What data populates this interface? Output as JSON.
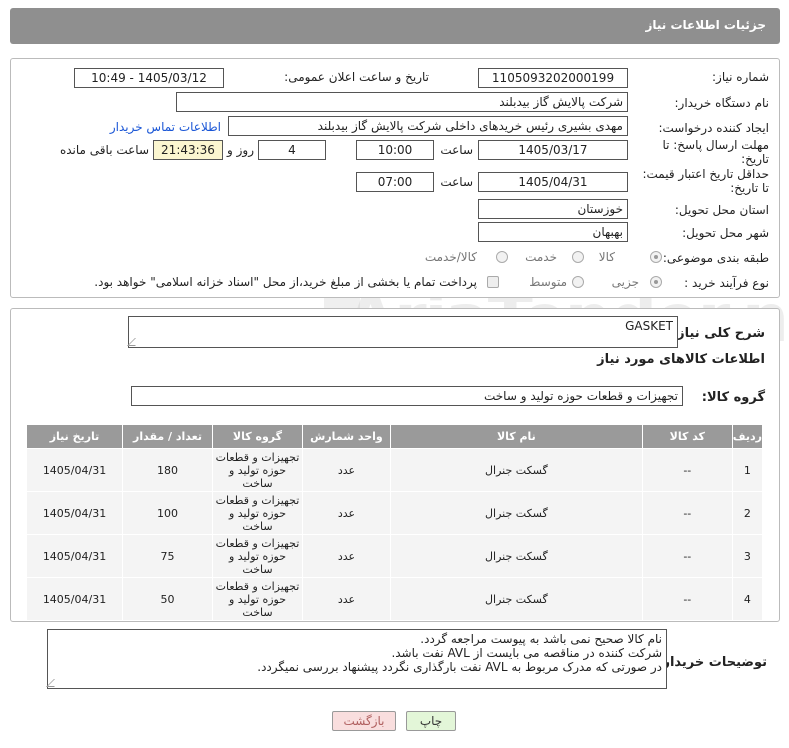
{
  "header": {
    "title": "جزئیات اطلاعات نیاز"
  },
  "form": {
    "need_number_label": "شماره نیاز:",
    "need_number": "1105093202000199",
    "announce_label": "تاریخ و ساعت اعلان عمومی:",
    "announce_value": "1405/03/12 - 10:49",
    "buyer_org_label": "نام دستگاه خریدار:",
    "buyer_org": "شرکت پالایش گاز بیدبلند",
    "creator_label": "ایجاد کننده درخواست:",
    "creator": "مهدی بشیری رئیس خریدهای داخلی شرکت پالایش گاز بیدبلند",
    "buyer_contact_link": "اطلاعات تماس خریدار",
    "deadline_label": "مهلت ارسال پاسخ: تا تاریخ:",
    "deadline_date": "1405/03/17",
    "time_label": "ساعت",
    "deadline_time": "10:00",
    "days_count": "4",
    "days_label": "روز و",
    "remaining_time": "21:43:36",
    "remaining_label": "ساعت باقی مانده",
    "validity_label": "حداقل تاریخ اعتبار قیمت: تا تاریخ:",
    "validity_date": "1405/04/31",
    "validity_time": "07:00",
    "province_label": "استان محل تحویل:",
    "province": "خوزستان",
    "city_label": "شهر محل تحویل:",
    "city": "بهبهان",
    "category_label": "طبقه بندی موضوعی:",
    "category_options": [
      "کالا",
      "خدمت",
      "کالا/خدمت"
    ],
    "process_label": "نوع فرآیند خرید :",
    "process_options": [
      "جزیی",
      "متوسط"
    ],
    "payment_note": "پرداخت تمام یا بخشی از مبلغ خرید،از محل \"اسناد خزانه اسلامی\" خواهد بود."
  },
  "summary": {
    "label": "شرح کلی نیاز:",
    "value": "GASKET",
    "goods_info_title": "اطلاعات کالاهای مورد نیاز",
    "goods_group_label": "گروه کالا:",
    "goods_group": "تجهیزات و قطعات حوزه تولید و ساخت"
  },
  "table": {
    "headers": [
      "ردیف",
      "کد کالا",
      "نام کالا",
      "واحد شمارش",
      "گروه کالا",
      "تعداد / مقدار",
      "تاریخ نیاز"
    ],
    "rows": [
      {
        "idx": "1",
        "code": "--",
        "name": "گسکت جنرال",
        "unit": "عدد",
        "group": "تجهیزات و قطعات حوزه تولید و ساخت",
        "qty": "180",
        "date": "1405/04/31"
      },
      {
        "idx": "2",
        "code": "--",
        "name": "گسکت جنرال",
        "unit": "عدد",
        "group": "تجهیزات و قطعات حوزه تولید و ساخت",
        "qty": "100",
        "date": "1405/04/31"
      },
      {
        "idx": "3",
        "code": "--",
        "name": "گسکت جنرال",
        "unit": "عدد",
        "group": "تجهیزات و قطعات حوزه تولید و ساخت",
        "qty": "75",
        "date": "1405/04/31"
      },
      {
        "idx": "4",
        "code": "--",
        "name": "گسکت جنرال",
        "unit": "عدد",
        "group": "تجهیزات و قطعات حوزه تولید و ساخت",
        "qty": "50",
        "date": "1405/04/31"
      }
    ]
  },
  "notes": {
    "label": "توضیحات خریدار:",
    "line1": "نام کالا صحیح نمی باشد به پیوست مراجعه گردد.",
    "line2": "شرکت کننده در مناقصه می بایست از AVL نفت باشد.",
    "line3": "در صورتی که مدرک مربوط به AVL نفت بارگذاری نگردد پیشنهاد بررسی نمیگردد."
  },
  "buttons": {
    "print": "چاپ",
    "back": "بازگشت"
  },
  "watermark": "AriaTender.net",
  "colors": {
    "header_bg": "#8f8f8f",
    "link": "#1a56d6",
    "print_bg": "#e3f6d8",
    "back_bg": "#f9dede",
    "back_text": "#b06060"
  }
}
